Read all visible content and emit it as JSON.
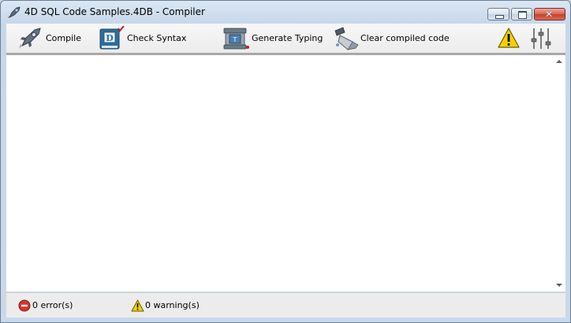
{
  "window": {
    "title": "4D SQL Code Samples.4DB - Compiler",
    "controls": {
      "minimize": "minimize",
      "maximize": "maximize",
      "close": "✕"
    }
  },
  "toolbar": {
    "compile_label": "Compile",
    "check_syntax_label": "Check Syntax",
    "generate_typing_label": "Generate Typing",
    "clear_compiled_label": "Clear compiled code",
    "warnings_icon": "warning-icon",
    "options_icon": "settings-sliders-icon"
  },
  "status": {
    "errors_text": "0 error(s)",
    "warnings_text": "0 warning(s)"
  },
  "colors": {
    "error": "#d9342b",
    "warning": "#f2c200",
    "toolbar_bg": "#efefef",
    "window_frame": "#c9d9ea"
  }
}
